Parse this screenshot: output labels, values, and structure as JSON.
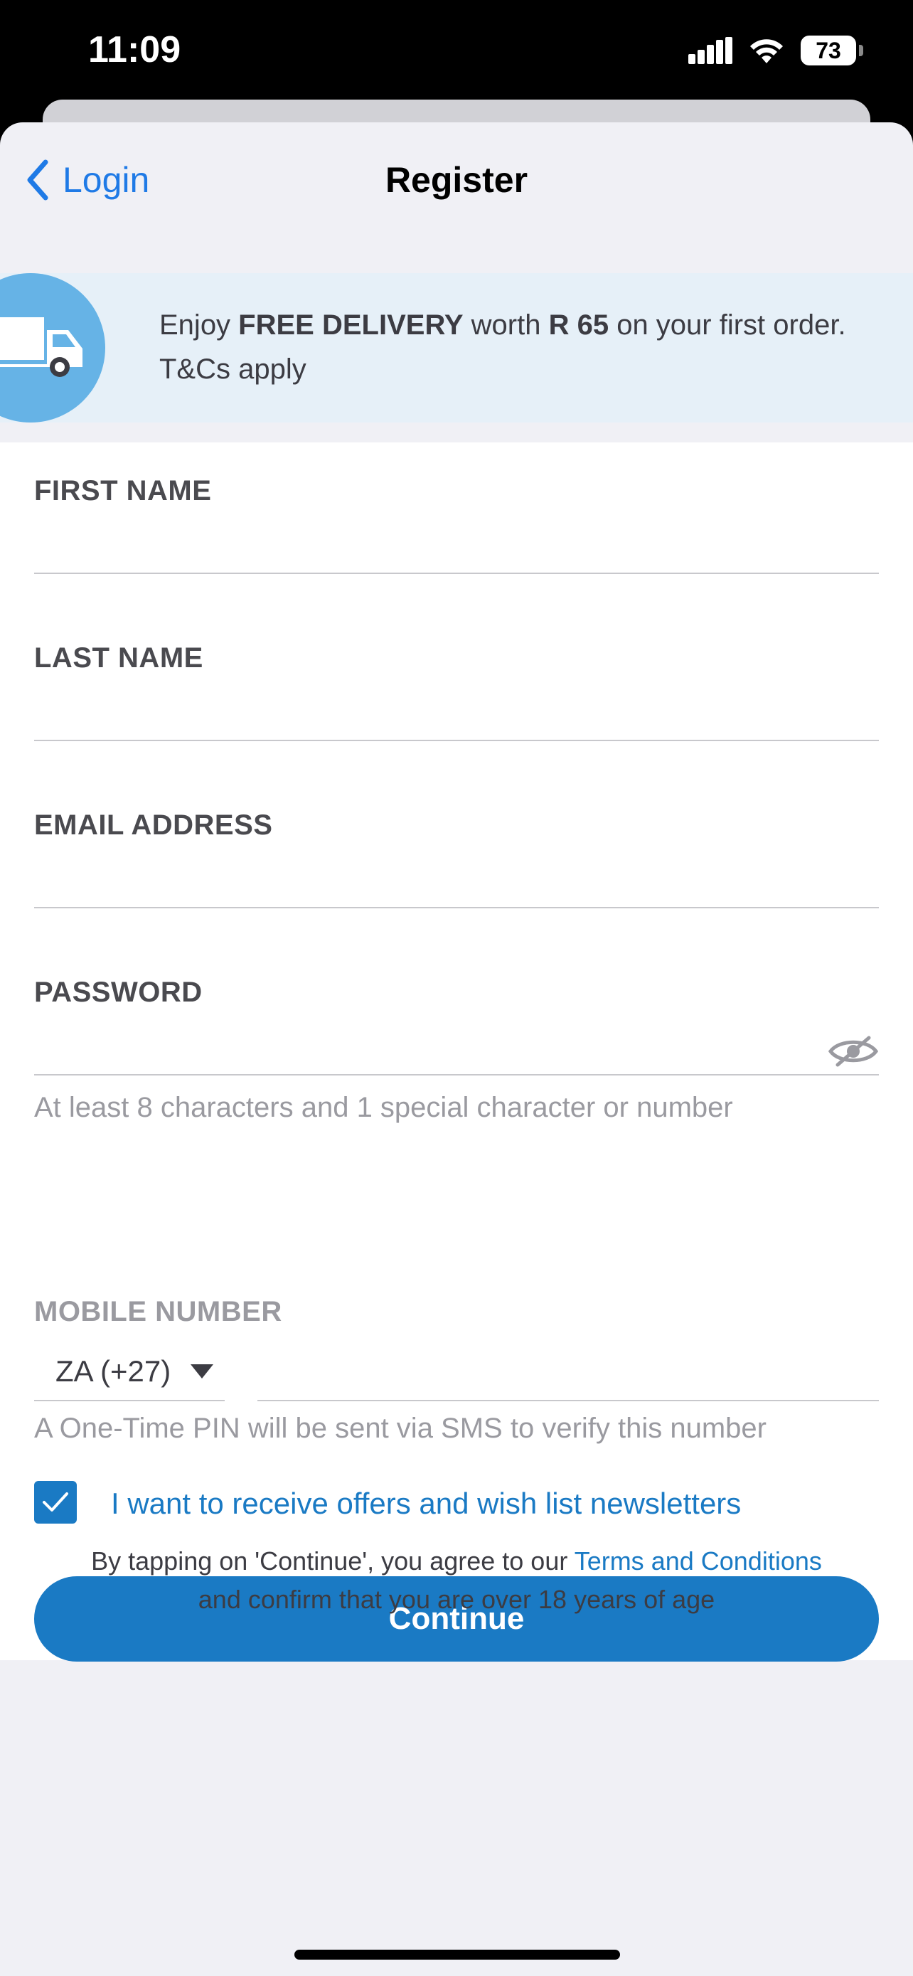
{
  "status_bar": {
    "time": "11:09",
    "battery": "73"
  },
  "nav": {
    "back_label": "Login",
    "title": "Register"
  },
  "promo": {
    "text_prefix": "Enjoy ",
    "highlight": "FREE DELIVERY",
    "text_middle": " worth ",
    "amount": "R 65",
    "text_suffix": " on your first order. T&Cs apply"
  },
  "form": {
    "first_name_label": "FIRST NAME",
    "last_name_label": "LAST NAME",
    "email_label": "EMAIL ADDRESS",
    "password_label": "PASSWORD",
    "password_hint": "At least 8 characters and 1 special character or number",
    "mobile_label": "MOBILE NUMBER",
    "country_code": "ZA (+27)",
    "mobile_hint": "A One-Time PIN will be sent via SMS to verify this number",
    "newsletter_label": "I want to receive offers and wish list newsletters",
    "newsletter_checked": true,
    "continue_label": "Continue"
  },
  "legal": {
    "prefix": "By tapping on 'Continue', you agree to our ",
    "link": "Terms and Conditions",
    "suffix": "and confirm that you are over 18 years of age"
  },
  "colors": {
    "accent": "#1a7ac4",
    "ios_blue": "#1f7ae6",
    "promo_bg": "#e6f0f8"
  }
}
